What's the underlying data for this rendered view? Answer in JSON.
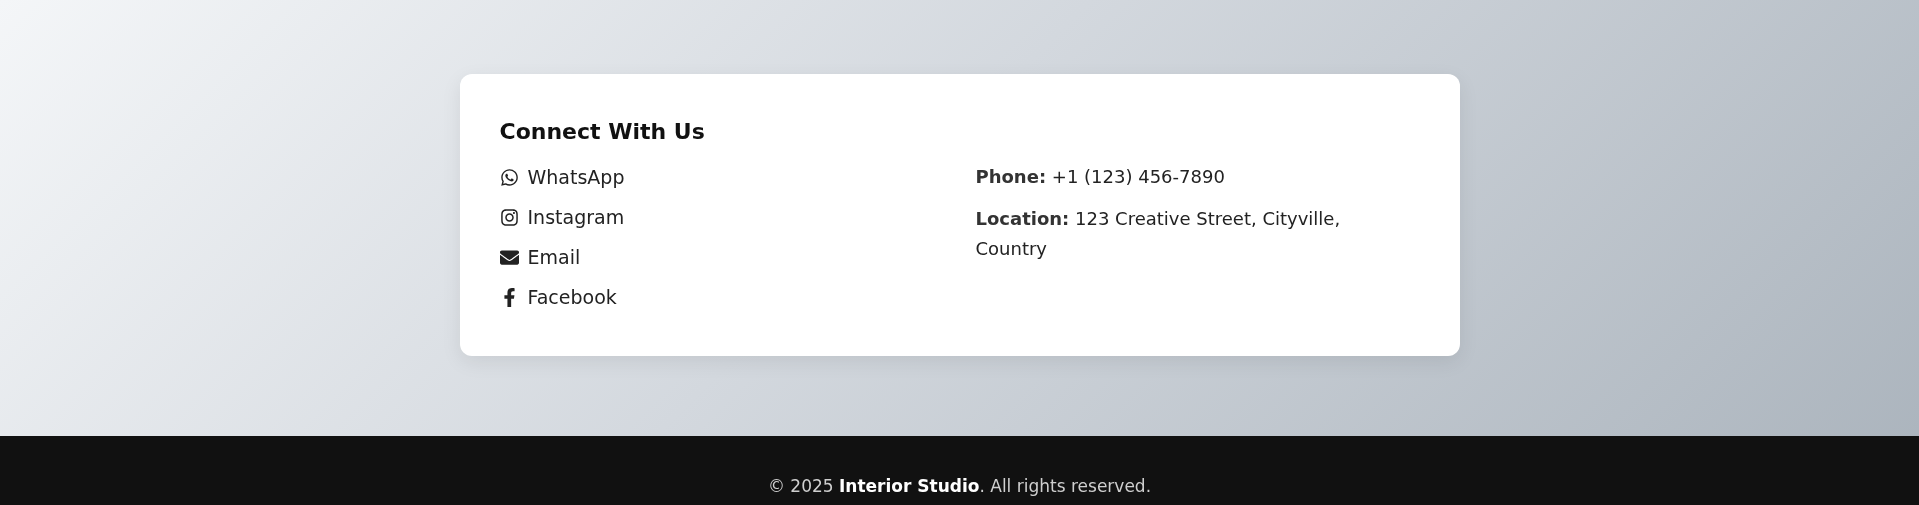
{
  "contact_card": {
    "title": "Connect With Us",
    "social_links": [
      {
        "kind": "whatsapp",
        "label": "WhatsApp"
      },
      {
        "kind": "instagram",
        "label": "Instagram"
      },
      {
        "kind": "email",
        "label": "Email"
      },
      {
        "kind": "facebook",
        "label": "Facebook"
      }
    ],
    "details": [
      "**Phone:** +1 (123) 456-7890",
      "**Location:** 123 Creative Street, Cityville, Country"
    ]
  },
  "footer": {
    "copyright": "© 2025 **Interior Studio**. All rights reserved."
  }
}
